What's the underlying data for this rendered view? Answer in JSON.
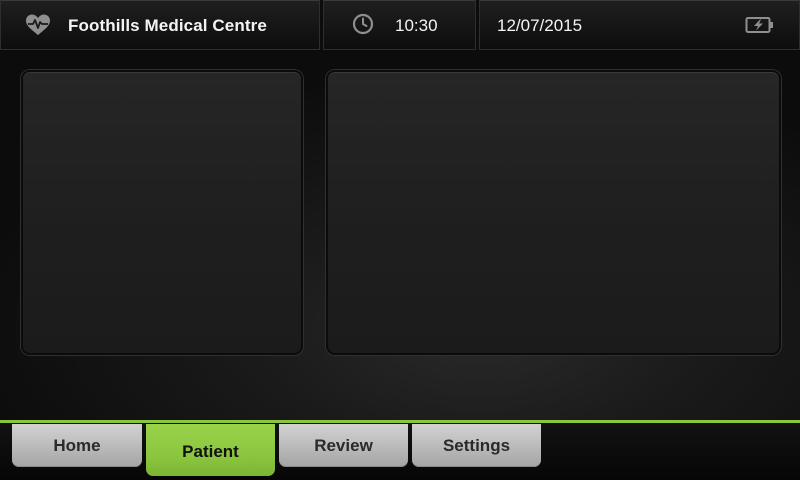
{
  "header": {
    "facility_name": "Foothills Medical Centre",
    "time": "10:30",
    "date": "12/07/2015",
    "icons": {
      "left": "heart-pulse-icon",
      "clock": "clock-icon",
      "battery": "battery-charging-icon"
    }
  },
  "nav": {
    "tabs": [
      {
        "label": "Home",
        "active": false
      },
      {
        "label": "Patient",
        "active": true
      },
      {
        "label": "Review",
        "active": false
      },
      {
        "label": "Settings",
        "active": false
      }
    ]
  },
  "colors": {
    "accent": "#8cc63f",
    "tab_inactive": "#b7b7b7",
    "background": "#1a1a1a",
    "text": "#f4f4f4"
  }
}
